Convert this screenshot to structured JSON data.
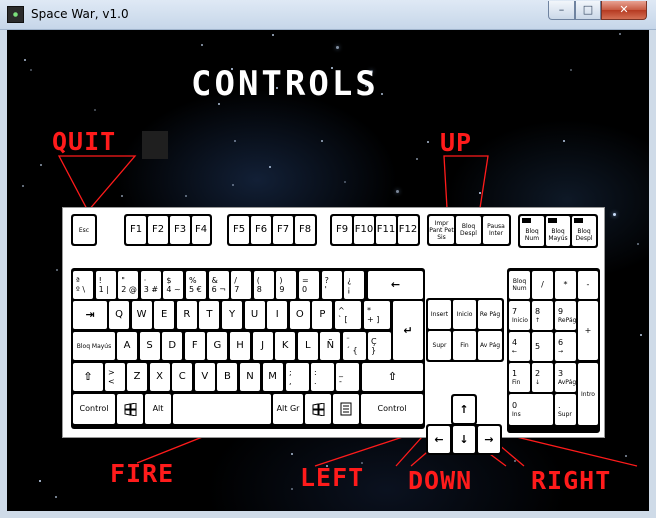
{
  "window": {
    "title": "Space War, v1.0",
    "minimize_glyph": "–",
    "maximize_glyph": "□",
    "close_glyph": "✕"
  },
  "screen": {
    "title": "CONTROLS",
    "labels": {
      "quit": "QUIT",
      "up": "UP",
      "fire": "FIRE",
      "left": "LEFT",
      "down": "DOWN",
      "right": "RIGHT"
    }
  },
  "keyboard": {
    "esc": "Esc",
    "function_keys": [
      "F1",
      "F2",
      "F3",
      "F4",
      "F5",
      "F6",
      "F7",
      "F8",
      "F9",
      "F10",
      "F11",
      "F12"
    ],
    "system_keys": [
      "Impr Pant Pet Sis",
      "Bloq Despl",
      "Pausa Inter"
    ],
    "indicators": [
      "Bloq Num",
      "Bloq Mayús",
      "Bloq Despl"
    ],
    "row_numbers": [
      {
        "top": "ª",
        "bottom": "º \\"
      },
      {
        "top": "!",
        "bottom": "1 |"
      },
      {
        "top": "\"",
        "bottom": "2 @"
      },
      {
        "top": "·",
        "bottom": "3 #"
      },
      {
        "top": "$",
        "bottom": "4 ~"
      },
      {
        "top": "%",
        "bottom": "5 €"
      },
      {
        "top": "&",
        "bottom": "6 ¬"
      },
      {
        "top": "/",
        "bottom": "7"
      },
      {
        "top": "(",
        "bottom": "8"
      },
      {
        "top": ")",
        "bottom": "9"
      },
      {
        "top": "=",
        "bottom": "0"
      },
      {
        "top": "?",
        "bottom": "'"
      },
      {
        "top": "¿",
        "bottom": "¡"
      }
    ],
    "backspace": "←",
    "tab": "⇥",
    "row_q": [
      "Q",
      "W",
      "E",
      "R",
      "T",
      "Y",
      "U",
      "I",
      "O",
      "P"
    ],
    "row_q_extra": [
      {
        "top": "^",
        "bottom": "` ["
      },
      {
        "top": "*",
        "bottom": "+ ]"
      }
    ],
    "enter": "↵",
    "caps": "Bloq Mayús",
    "row_a": [
      "A",
      "S",
      "D",
      "F",
      "G",
      "H",
      "J",
      "K",
      "L",
      "Ñ"
    ],
    "row_a_extra": [
      {
        "top": "¨",
        "bottom": "´ {"
      },
      {
        "top": "Ç",
        "bottom": "}"
      }
    ],
    "shift_left": "⇧",
    "row_z_first": {
      "top": ">",
      "bottom": "<"
    },
    "row_z": [
      "Z",
      "X",
      "C",
      "V",
      "B",
      "N",
      "M"
    ],
    "row_z_extra": [
      {
        "top": ";",
        "bottom": ","
      },
      {
        "top": ":",
        "bottom": "."
      },
      {
        "top": "_",
        "bottom": "-"
      }
    ],
    "shift_right": "⇧",
    "bottom_row": [
      "Control",
      "Alt",
      "Alt Gr",
      "Control"
    ],
    "nav_keys": [
      "Insert",
      "Inicio",
      "Re Pág",
      "Supr",
      "Fin",
      "Av Pág"
    ],
    "arrows": {
      "up": "↑",
      "left": "←",
      "down": "↓",
      "right": "→"
    },
    "numpad": {
      "top": [
        "Bloq Num",
        "/",
        "*",
        "-"
      ],
      "row7": [
        {
          "num": "7",
          "sub": "Inicio"
        },
        {
          "num": "8",
          "sub": "↑"
        },
        {
          "num": "9",
          "sub": "RePág"
        }
      ],
      "plus": "+",
      "row4": [
        {
          "num": "4",
          "sub": "←"
        },
        {
          "num": "5",
          "sub": ""
        },
        {
          "num": "6",
          "sub": "→"
        }
      ],
      "row1": [
        {
          "num": "1",
          "sub": "Fin"
        },
        {
          "num": "2",
          "sub": "↓"
        },
        {
          "num": "3",
          "sub": "AvPág"
        }
      ],
      "intro": "Intro",
      "zero": {
        "num": "0",
        "sub": "Ins"
      },
      "dot": {
        "num": ".",
        "sub": "Supr"
      }
    }
  },
  "colors": {
    "label_red": "#ff1b1b",
    "title_white": "#ffffff",
    "background": "#000000"
  }
}
